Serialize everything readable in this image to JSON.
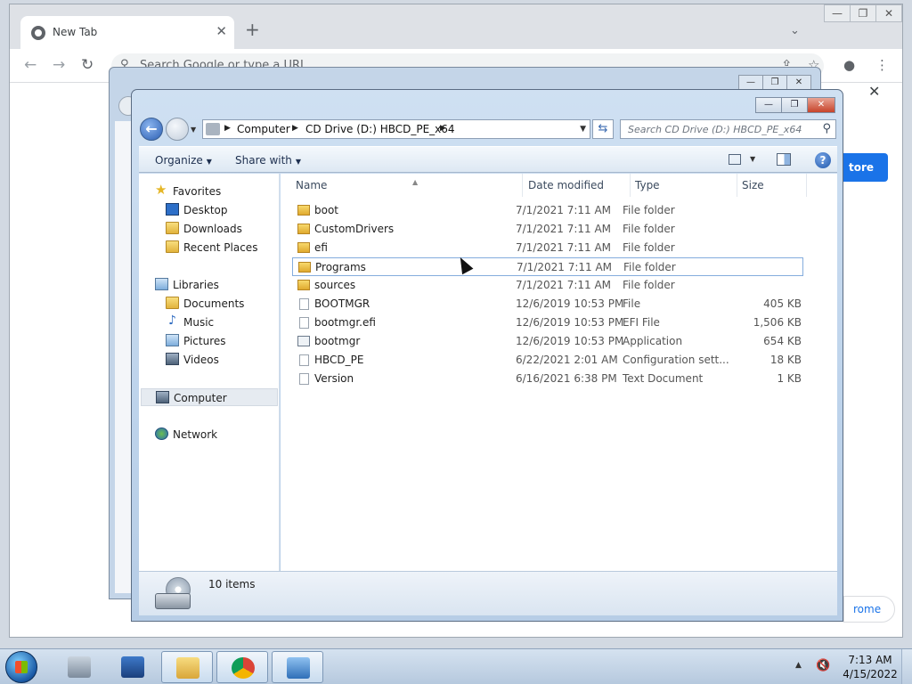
{
  "browser": {
    "tab_title": "New Tab",
    "tab_close": "✕",
    "new_tab": "+",
    "omnibox_placeholder": "Search Google or type a URL",
    "ntp_store_label": "tore",
    "ntp_chrome_label": "rome"
  },
  "explorer": {
    "address": [
      "Computer",
      "CD Drive (D:) HBCD_PE_x64"
    ],
    "search_placeholder": "Search CD Drive (D:) HBCD_PE_x64",
    "toolbar": {
      "organize": "Organize",
      "share_with": "Share with"
    },
    "nav": {
      "favorites": "Favorites",
      "desktop": "Desktop",
      "downloads": "Downloads",
      "recent_places": "Recent Places",
      "libraries": "Libraries",
      "documents": "Documents",
      "music": "Music",
      "pictures": "Pictures",
      "videos": "Videos",
      "computer": "Computer",
      "network": "Network"
    },
    "columns": {
      "name": "Name",
      "date": "Date modified",
      "type": "Type",
      "size": "Size"
    },
    "files": [
      {
        "name": "boot",
        "date": "7/1/2021 7:11 AM",
        "type": "File folder",
        "size": "",
        "icon": "folder"
      },
      {
        "name": "CustomDrivers",
        "date": "7/1/2021 7:11 AM",
        "type": "File folder",
        "size": "",
        "icon": "folder"
      },
      {
        "name": "efi",
        "date": "7/1/2021 7:11 AM",
        "type": "File folder",
        "size": "",
        "icon": "folder"
      },
      {
        "name": "Programs",
        "date": "7/1/2021 7:11 AM",
        "type": "File folder",
        "size": "",
        "icon": "folder"
      },
      {
        "name": "sources",
        "date": "7/1/2021 7:11 AM",
        "type": "File folder",
        "size": "",
        "icon": "folder"
      },
      {
        "name": "BOOTMGR",
        "date": "12/6/2019 10:53 PM",
        "type": "File",
        "size": "405 KB",
        "icon": "file"
      },
      {
        "name": "bootmgr.efi",
        "date": "12/6/2019 10:53 PM",
        "type": "EFI File",
        "size": "1,506 KB",
        "icon": "file"
      },
      {
        "name": "bootmgr",
        "date": "12/6/2019 10:53 PM",
        "type": "Application",
        "size": "654 KB",
        "icon": "app"
      },
      {
        "name": "HBCD_PE",
        "date": "6/22/2021 2:01 AM",
        "type": "Configuration sett...",
        "size": "18 KB",
        "icon": "file"
      },
      {
        "name": "Version",
        "date": "6/16/2021 6:38 PM",
        "type": "Text Document",
        "size": "1 KB",
        "icon": "file"
      }
    ],
    "status_items": "10 items"
  },
  "taskbar": {
    "time": "7:13 AM",
    "date": "4/15/2022"
  }
}
